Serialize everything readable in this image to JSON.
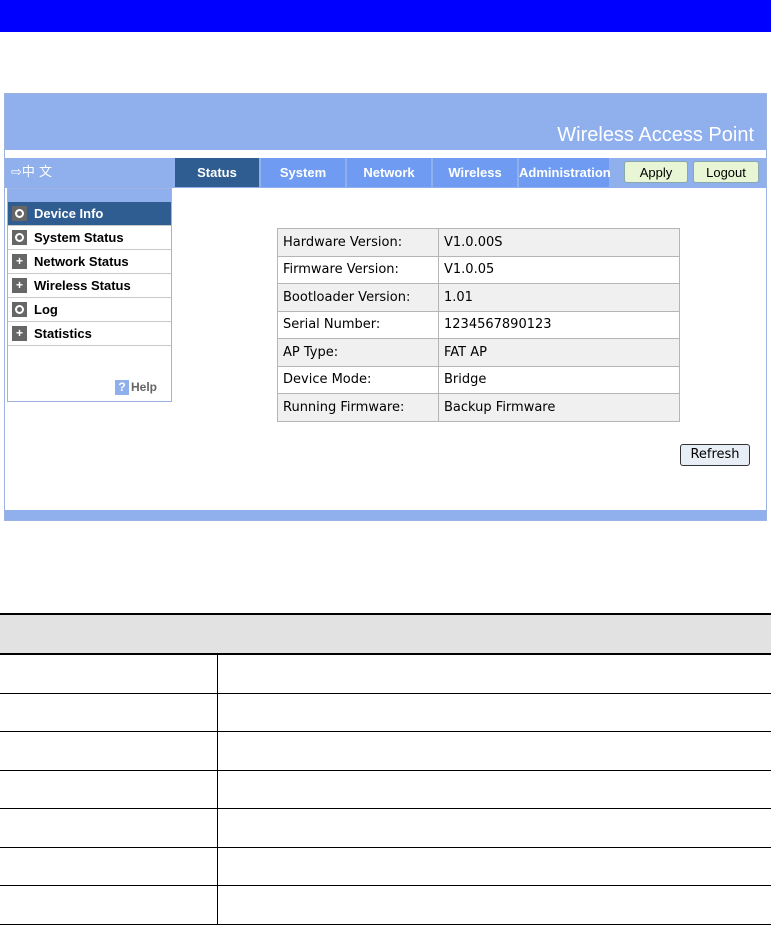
{
  "ui": {
    "brand": "Wireless Access Point",
    "language_link": "⇨中 文",
    "tabs": [
      "Status",
      "System",
      "Network",
      "Wireless",
      "Administration"
    ],
    "active_tab": "Status",
    "buttons": {
      "apply": "Apply",
      "logout": "Logout",
      "refresh": "Refresh"
    },
    "sidebar": {
      "items": [
        {
          "label": "Device Info",
          "icon": "circle-icon",
          "active": true
        },
        {
          "label": "System Status",
          "icon": "circle-icon",
          "active": false
        },
        {
          "label": "Network Status",
          "icon": "plus-icon",
          "active": false
        },
        {
          "label": "Wireless Status",
          "icon": "plus-icon",
          "active": false
        },
        {
          "label": "Log",
          "icon": "circle-icon",
          "active": false
        },
        {
          "label": "Statistics",
          "icon": "plus-icon",
          "active": false
        }
      ],
      "help": "Help"
    },
    "device_info": [
      {
        "key": "Hardware Version:",
        "value": "V1.0.00S"
      },
      {
        "key": "Firmware Version:",
        "value": "V1.0.05"
      },
      {
        "key": "Bootloader Version:",
        "value": "1.01"
      },
      {
        "key": "Serial Number:",
        "value": "1234567890123"
      },
      {
        "key": "AP Type:",
        "value": "FAT AP"
      },
      {
        "key": "Device Mode:",
        "value": "Bridge"
      },
      {
        "key": "Running Firmware:",
        "value": "Backup Firmware"
      }
    ]
  },
  "colors": {
    "top_bar": "#0000ff",
    "header": "#8fb0ec",
    "tab": "#6f9cf2",
    "active": "#2f5d92"
  }
}
